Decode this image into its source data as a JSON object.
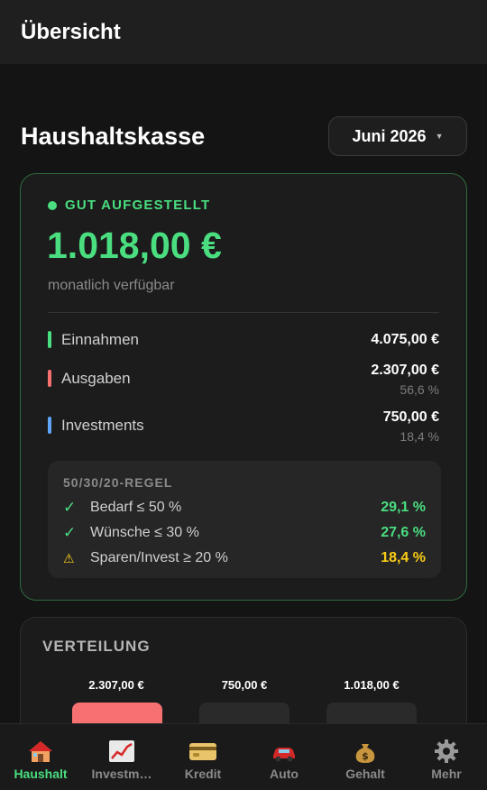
{
  "app_bar": {
    "title": "Übersicht"
  },
  "header": {
    "title": "Haushaltskasse",
    "month": "Juni 2026"
  },
  "summary": {
    "status": "GUT AUFGESTELLT",
    "amount": "1.018,00 €",
    "subtitle": "monatlich verfügbar",
    "rows": [
      {
        "label": "Einnahmen",
        "value": "4.075,00 €",
        "percent": "",
        "color": "#4ade80"
      },
      {
        "label": "Ausgaben",
        "value": "2.307,00 €",
        "percent": "56,6 %",
        "color": "#f87171"
      },
      {
        "label": "Investments",
        "value": "750,00 €",
        "percent": "18,4 %",
        "color": "#60a5fa"
      }
    ]
  },
  "rule": {
    "title": "50/30/20-REGEL",
    "items": [
      {
        "icon": "check-icon",
        "label": "Bedarf ≤ 50 %",
        "value": "29,1 %",
        "color": "#4ade80"
      },
      {
        "icon": "check-icon",
        "label": "Wünsche ≤ 30 %",
        "value": "27,6 %",
        "color": "#4ade80"
      },
      {
        "icon": "warning-icon",
        "label": "Sparen/Invest ≥ 20 %",
        "value": "18,4 %",
        "color": "#facc15"
      }
    ]
  },
  "distribution": {
    "title": "VERTEILUNG",
    "bars": [
      {
        "value": "2.307,00 €",
        "color": "#f87171"
      },
      {
        "value": "750,00 €",
        "color": "#2a2a2a"
      },
      {
        "value": "1.018,00 €",
        "color": "#2a2a2a"
      }
    ]
  },
  "nav": {
    "items": [
      {
        "label": "Haushalt",
        "icon": "house-icon",
        "active": true
      },
      {
        "label": "Investm…",
        "icon": "chart-icon",
        "active": false
      },
      {
        "label": "Kredit",
        "icon": "credit-card-icon",
        "active": false
      },
      {
        "label": "Auto",
        "icon": "car-icon",
        "active": false
      },
      {
        "label": "Gehalt",
        "icon": "money-bag-icon",
        "active": false
      },
      {
        "label": "Mehr",
        "icon": "gear-icon",
        "active": false
      }
    ]
  }
}
